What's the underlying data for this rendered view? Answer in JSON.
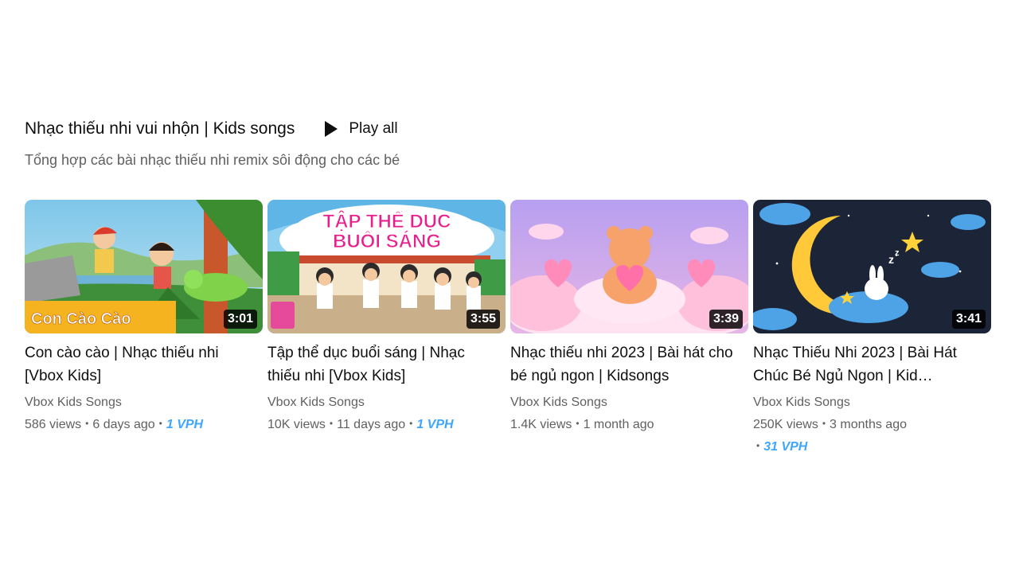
{
  "shelf": {
    "title": "Nhạc thiếu nhi vui nhộn | Kids songs",
    "play_all_label": "Play all",
    "play_icon": "play-icon",
    "description": "Tổng hợp các bài nhạc thiếu nhi remix sôi động cho các bé"
  },
  "videos": [
    {
      "title": "Con cào cào | Nhạc thiếu nhi [Vbox Kids]",
      "thumb_text": "Con Cào Cào",
      "duration": "3:01",
      "channel": "Vbox Kids Songs",
      "views": "586 views",
      "age": "6 days ago",
      "vph": "1 VPH"
    },
    {
      "title": "Tập thể dục buổi sáng | Nhạc thiếu nhi [Vbox Kids]",
      "thumb_text_line1": "TẬP THỂ DỤC",
      "thumb_text_line2": "BUỔI SÁNG",
      "duration": "3:55",
      "channel": "Vbox Kids Songs",
      "views": "10K views",
      "age": "11 days ago",
      "vph": "1 VPH"
    },
    {
      "title": "Nhạc thiếu nhi 2023 | Bài hát cho bé ngủ ngon | Kidsongs",
      "duration": "3:39",
      "channel": "Vbox Kids Songs",
      "views": "1.4K views",
      "age": "1 month ago"
    },
    {
      "title": "Nhạc Thiếu Nhi 2023 | Bài Hát Chúc Bé Ngủ Ngon | Kid…",
      "duration": "3:41",
      "channel": "Vbox Kids Songs",
      "views": "250K views",
      "age": "3 months ago",
      "vph": "31 VPH"
    }
  ],
  "colors": {
    "vph": "#3ea6ff",
    "secondary_text": "#606060",
    "primary_text": "#0f0f0f"
  }
}
